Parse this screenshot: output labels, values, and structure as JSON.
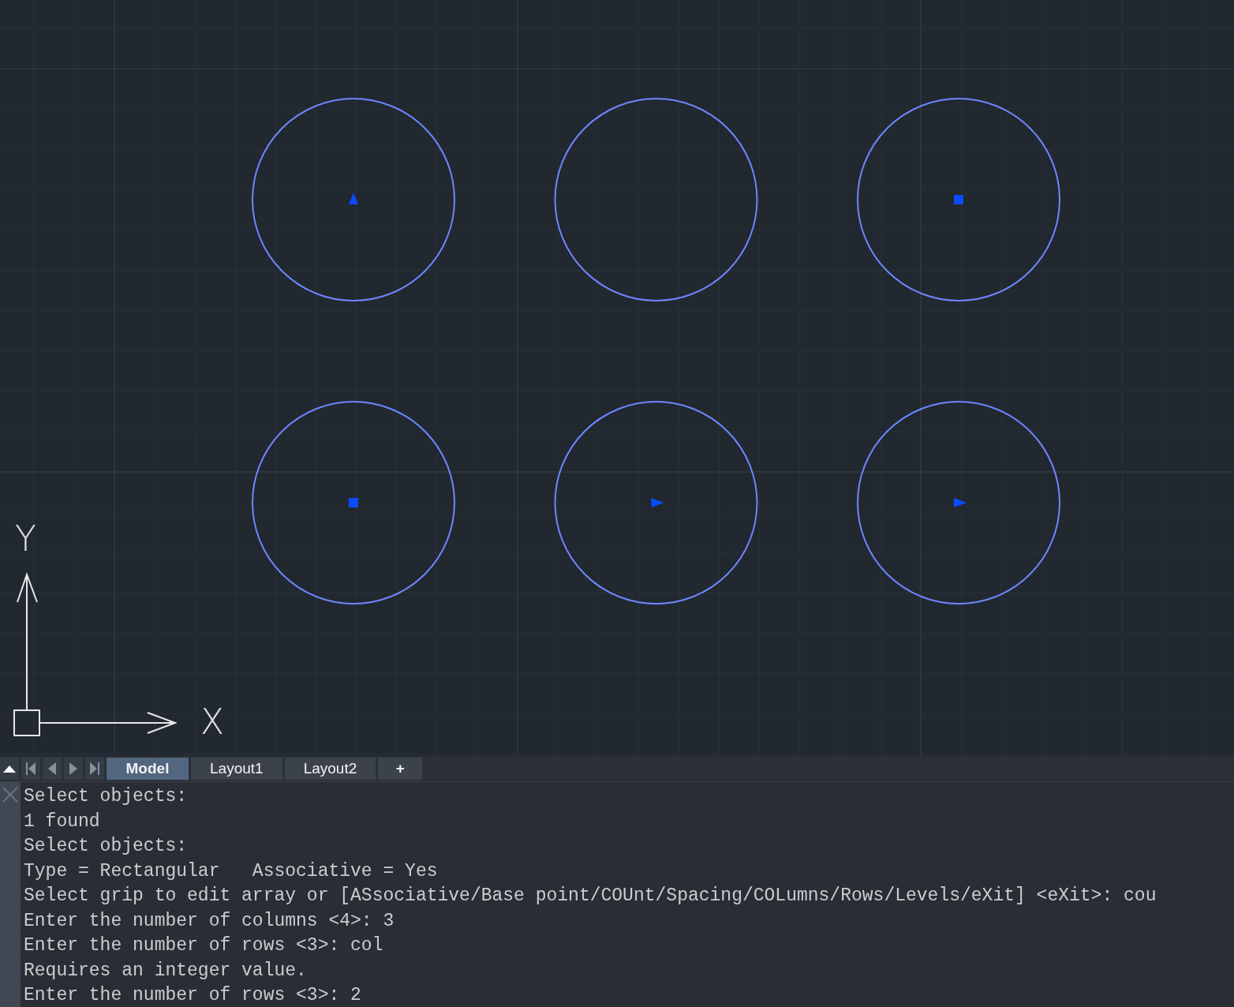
{
  "drawing": {
    "circles": [
      {
        "kind": "triangle-up"
      },
      {
        "kind": "none"
      },
      {
        "kind": "square"
      },
      {
        "kind": "square"
      },
      {
        "kind": "triangle-right"
      },
      {
        "kind": "triangle-right"
      }
    ],
    "ucs": {
      "x_label": "X",
      "y_label": "Y"
    }
  },
  "tabs": [
    {
      "label": "Model",
      "selected": true
    },
    {
      "label": "Layout1",
      "selected": false
    },
    {
      "label": "Layout2",
      "selected": false
    }
  ],
  "new_tab": "+",
  "command_history": [
    "Select objects:",
    "1 found",
    "Select objects:",
    "Type = Rectangular   Associative = Yes",
    "Select grip to edit array or [ASsociative/Base point/COUnt/Spacing/COLumns/Rows/Levels/eXit] <eXit>: cou",
    "Enter the number of columns <4>: 3",
    "Enter the number of rows <3>: col",
    "Requires an integer value.",
    "Enter the number of rows <3>: 2"
  ]
}
